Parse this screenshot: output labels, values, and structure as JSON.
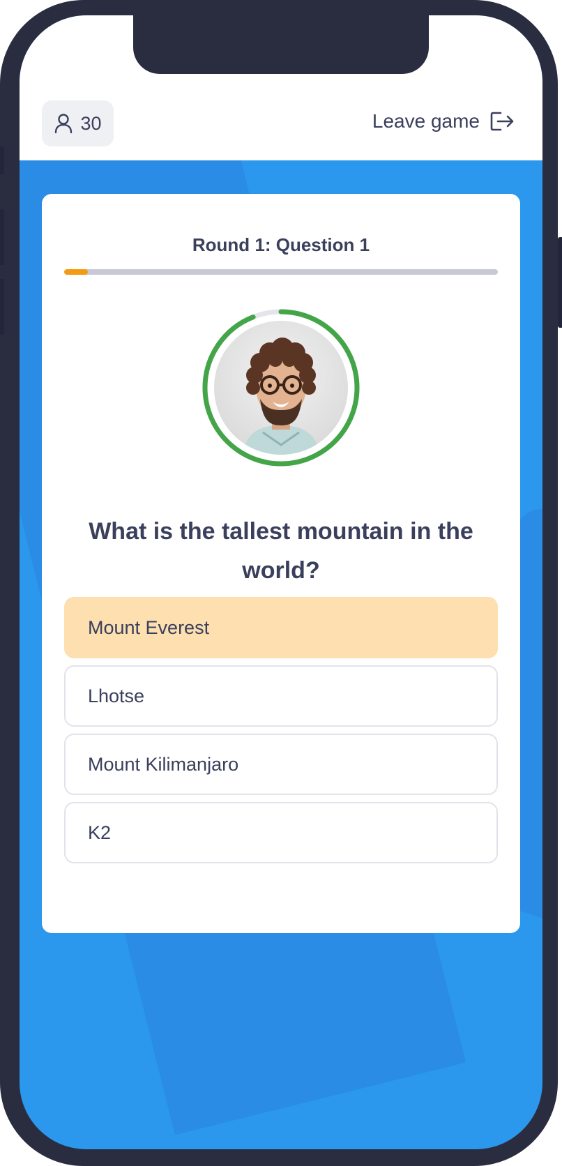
{
  "header": {
    "player_count": "30",
    "leave_label": "Leave game"
  },
  "quiz": {
    "round_title": "Round 1: Question 1",
    "progress": 0.055,
    "timer_remaining": 0.94,
    "question": "What is the tallest mountain in the world?",
    "answers": [
      "Mount Everest",
      "Lhotse",
      "Mount Kilimanjaro",
      "K2"
    ],
    "selected_index": 0
  },
  "colors": {
    "accent": "#f39c12",
    "timer": "#43a548",
    "background": "#2b98ed",
    "selected_answer": "#fddfb0",
    "text": "#3a3f5c"
  }
}
